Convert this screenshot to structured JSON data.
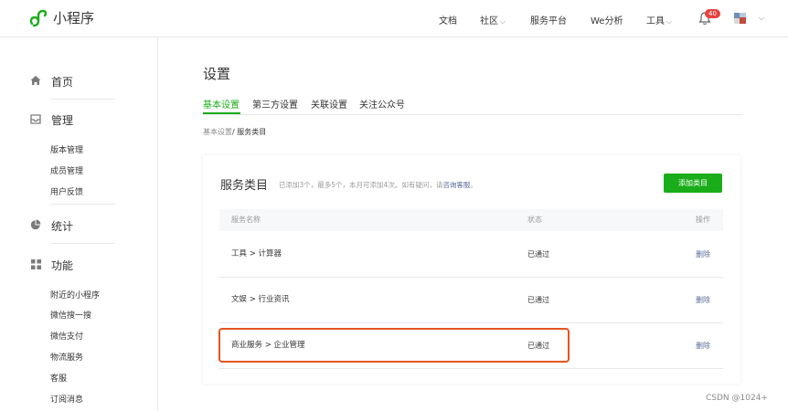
{
  "app": {
    "logo_text": "小程序",
    "logo_icon": "miniprogram-logo-icon",
    "brand_color": "#1aad19"
  },
  "topnav": {
    "items": [
      {
        "label": "文档",
        "has_dropdown": false
      },
      {
        "label": "社区",
        "has_dropdown": true
      },
      {
        "label": "服务平台",
        "has_dropdown": false
      },
      {
        "label": "We分析",
        "has_dropdown": false
      },
      {
        "label": "工具",
        "has_dropdown": true
      }
    ],
    "chevron": "⌵",
    "notification_count": "40",
    "notification_icon": "bell-icon",
    "avatar_icon": "account-avatar-icon"
  },
  "sidebar": {
    "sections": [
      {
        "label": "首页",
        "icon": "home-icon",
        "items": []
      },
      {
        "label": "管理",
        "icon": "inbox-icon",
        "items": [
          "版本管理",
          "成员管理",
          "用户反馈"
        ]
      },
      {
        "label": "统计",
        "icon": "pie-chart-icon",
        "items": []
      },
      {
        "label": "功能",
        "icon": "grid-icon",
        "items": [
          "附近的小程序",
          "微信搜一搜",
          "微信支付",
          "物流服务",
          "客服",
          "订阅消息"
        ]
      }
    ]
  },
  "main": {
    "title": "设置",
    "tabs": [
      {
        "label": "基本设置",
        "active": true
      },
      {
        "label": "第三方设置",
        "active": false
      },
      {
        "label": "关联设置",
        "active": false
      },
      {
        "label": "关注公众号",
        "active": false
      }
    ],
    "breadcrumb": {
      "parent": "基本设置",
      "separator": "/ ",
      "current": "服务类目"
    },
    "card": {
      "title": "服务类目",
      "hint_text": "已添加3个，最多5个，本月可添加4次。如有疑问，请",
      "hint_link": "咨询客服",
      "hint_end": "。",
      "add_button": "添加类目",
      "columns": {
        "name": "服务名称",
        "status": "状态",
        "action": "操作"
      },
      "rows": [
        {
          "name": "工具 > 计算器",
          "status": "已通过",
          "action": "删除",
          "highlighted": false
        },
        {
          "name": "文娱 > 行业资讯",
          "status": "已通过",
          "action": "删除",
          "highlighted": false
        },
        {
          "name": "商业服务 > 企业管理",
          "status": "已通过",
          "action": "删除",
          "highlighted": true
        }
      ],
      "highlight_color": "#e8541e"
    }
  },
  "watermark": "CSDN @1024+"
}
